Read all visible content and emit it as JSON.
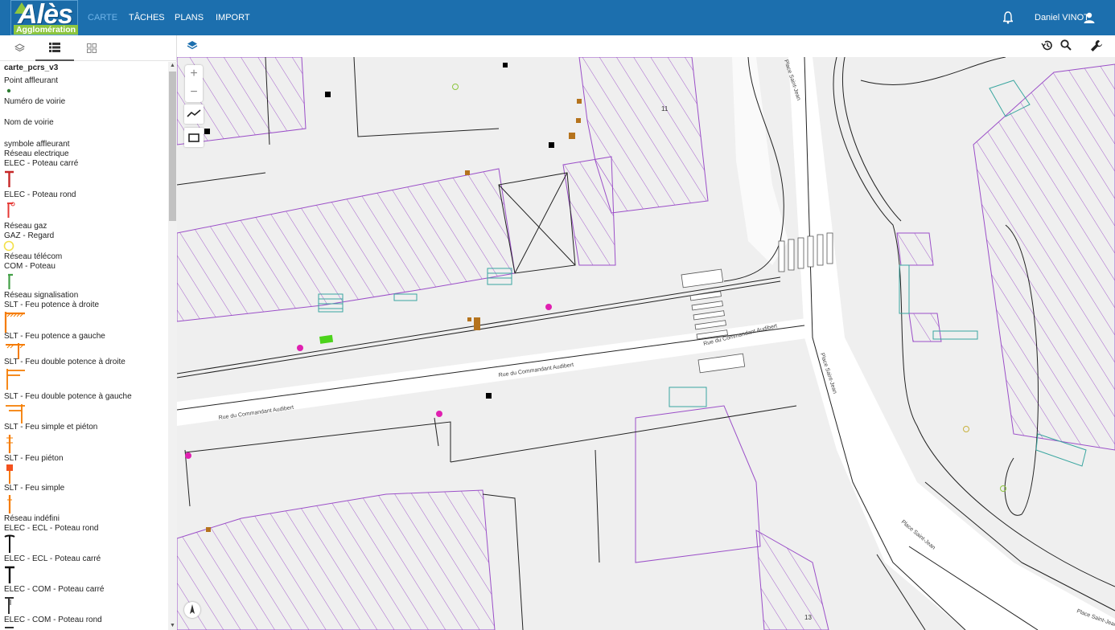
{
  "brand": {
    "logo_text": "Alès",
    "logo_subtext": "Agglomération"
  },
  "nav": {
    "items": [
      "CARTE",
      "TÂCHES",
      "PLANS",
      "IMPORT"
    ],
    "active": "CARTE"
  },
  "user": {
    "name": "Daniel VINOT"
  },
  "panel_tabs": [
    "layers-icon",
    "legend-list-icon",
    "grid-icon"
  ],
  "legend": {
    "title": "carte_pcrs_v3",
    "entries": [
      "Point affleurant",
      "Numéro de voirie",
      "Nom de voirie",
      "symbole affleurant",
      "Réseau electrique",
      "ELEC - Poteau carré",
      "ELEC - Poteau rond",
      "Réseau gaz",
      "GAZ - Regard",
      "Réseau télécom",
      "COM - Poteau",
      "Réseau signalisation",
      "SLT - Feu potence à droite",
      "SLT - Feu potence a gauche",
      "SLT - Feu double potence à droite",
      "SLT - Feu double potence à gauche",
      "SLT - Feu simple et piéton",
      "SLT - Feu piéton",
      "SLT - Feu simple",
      "Réseau indéfini",
      "ELEC - ECL - Poteau rond",
      "ELEC - ECL - Poteau carré",
      "ELEC - COM - Poteau carré",
      "ELEC - COM - Poteau rond"
    ]
  },
  "map": {
    "street_labels": [
      "Rue du Commandant Audibert",
      "Rue du Commandant Audibert",
      "Rue du Commandant Audibert",
      "Place Saint-Jean",
      "Place Saint-Jean",
      "Place Saint-Jean",
      "Place Saint-Jean"
    ],
    "building_numbers": [
      "11",
      "13"
    ],
    "zoom_in": "+",
    "zoom_out": "−"
  },
  "colors": {
    "topbar": "#1c6fae",
    "accent_nav": "#6fb3e8",
    "building_hatch": "#9b4fc8",
    "road_line": "#222222",
    "gas_marker": "#b5731d",
    "telecom_marker": "#e020b0",
    "signal_marker": "#4cd31b",
    "stairs": "#3aa6a0"
  }
}
